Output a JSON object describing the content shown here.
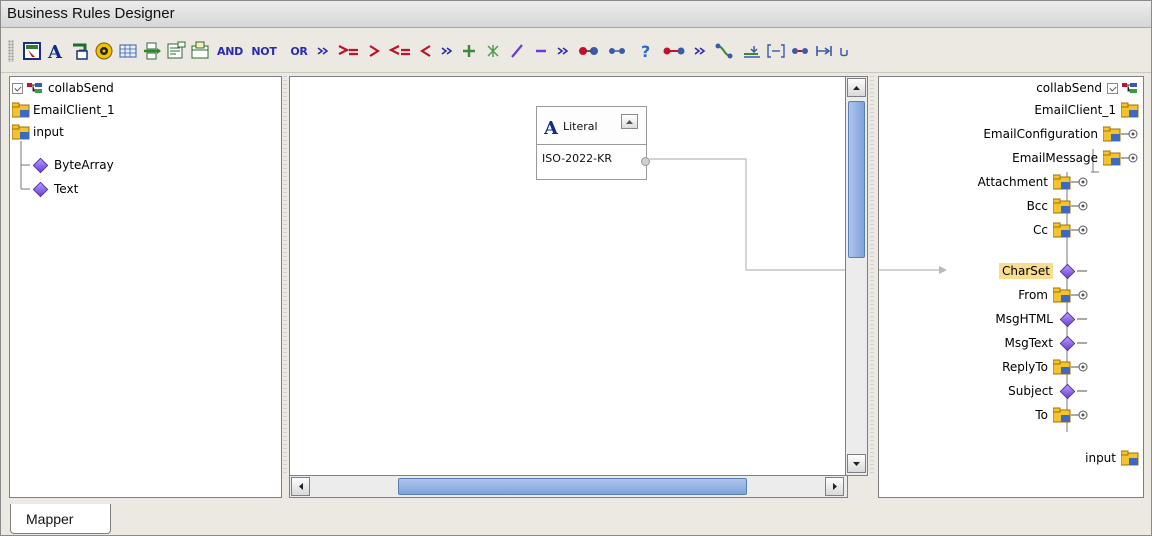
{
  "window": {
    "title": "Business Rules Designer"
  },
  "toolbar": {
    "logic_labels": [
      "AND",
      "NOT",
      "OR"
    ],
    "icons": [
      "select-icon",
      "literal-A-icon",
      "tree-arrow-icon",
      "gear-badge-icon",
      "grid-icon",
      "insert-node-icon",
      "form-icon",
      "calendar-icon",
      "and",
      "not",
      "or",
      "chevron-double-icon",
      "gte-icon",
      "gt-icon",
      "lte-icon",
      "lt-icon",
      "chevron-double-icon",
      "plus-icon",
      "multiply-icon",
      "divide-icon",
      "minus-icon",
      "chevron-double-icon",
      "connect-icon",
      "disconnect-icon",
      "question-icon",
      "route-icon",
      "chevron-double-icon",
      "branch-icon",
      "push-icon",
      "bracket-icon",
      "link-icon",
      "shift-icon",
      "wrap-icon"
    ]
  },
  "left_tree": {
    "root": "collabSend",
    "items": [
      "EmailClient_1",
      "input"
    ],
    "children": [
      "ByteArray",
      "Text"
    ]
  },
  "literal": {
    "title": "Literal",
    "value": "ISO-2022-KR"
  },
  "right_tree": {
    "root": "collabSend",
    "items": [
      "EmailClient_1",
      "EmailConfiguration",
      "EmailMessage",
      "Attachment",
      "Bcc",
      "Cc",
      "CharSet",
      "From",
      "MsgHTML",
      "MsgText",
      "ReplyTo",
      "Subject",
      "To",
      "input"
    ],
    "highlighted": "CharSet"
  },
  "tabs": {
    "mapper": "Mapper"
  },
  "colors": {
    "accent": "#2b2bb0",
    "highlight": "#f8dd8d",
    "thumb": "#7ea3da"
  }
}
